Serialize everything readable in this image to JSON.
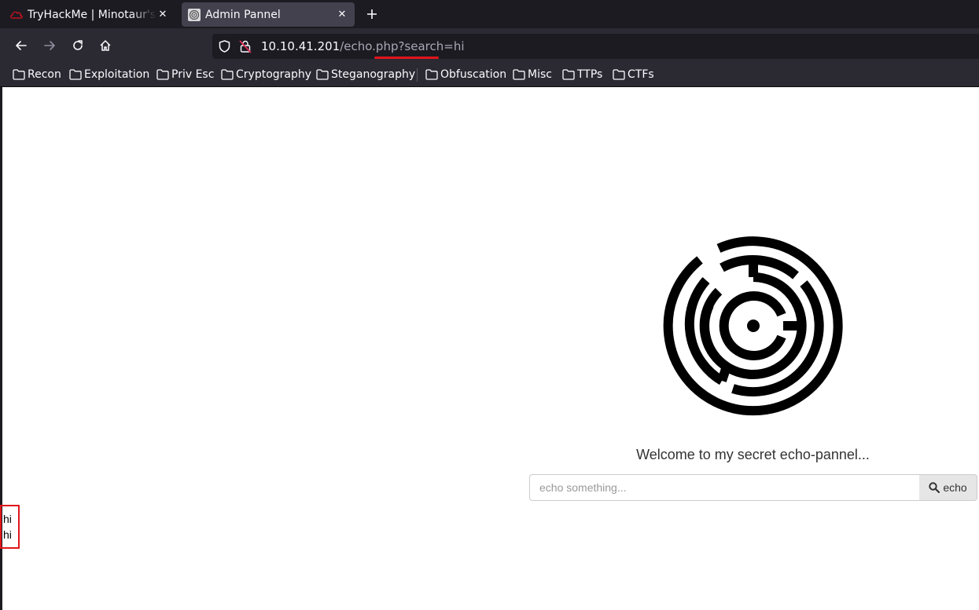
{
  "browser": {
    "tabs": [
      {
        "title": "TryHackMe | Minotaur's Labyrinth",
        "icon": "tryhackme-icon",
        "active": false
      },
      {
        "title": "Admin Pannel",
        "icon": "globe-icon",
        "active": true
      }
    ],
    "url": {
      "host": "10.10.41.201",
      "path": "/echo.php?search=hi"
    },
    "bookmarks": [
      {
        "label": "Recon"
      },
      {
        "label": "Exploitation"
      },
      {
        "label": "Priv Esc"
      },
      {
        "label": "Cryptography"
      },
      {
        "label": "Steganography"
      },
      {
        "label": "Obfuscation"
      },
      {
        "label": "Misc"
      },
      {
        "label": "TTPs"
      },
      {
        "label": "CTFs"
      }
    ],
    "colors": {
      "tab_strip": "#1c1b22",
      "toolbar": "#2b2a33",
      "annotation": "#e0161b"
    }
  },
  "page": {
    "welcome": "Welcome to my secret echo-pannel...",
    "search": {
      "placeholder": "echo something...",
      "button_label": "echo"
    },
    "output": [
      "hi",
      "hi"
    ]
  }
}
